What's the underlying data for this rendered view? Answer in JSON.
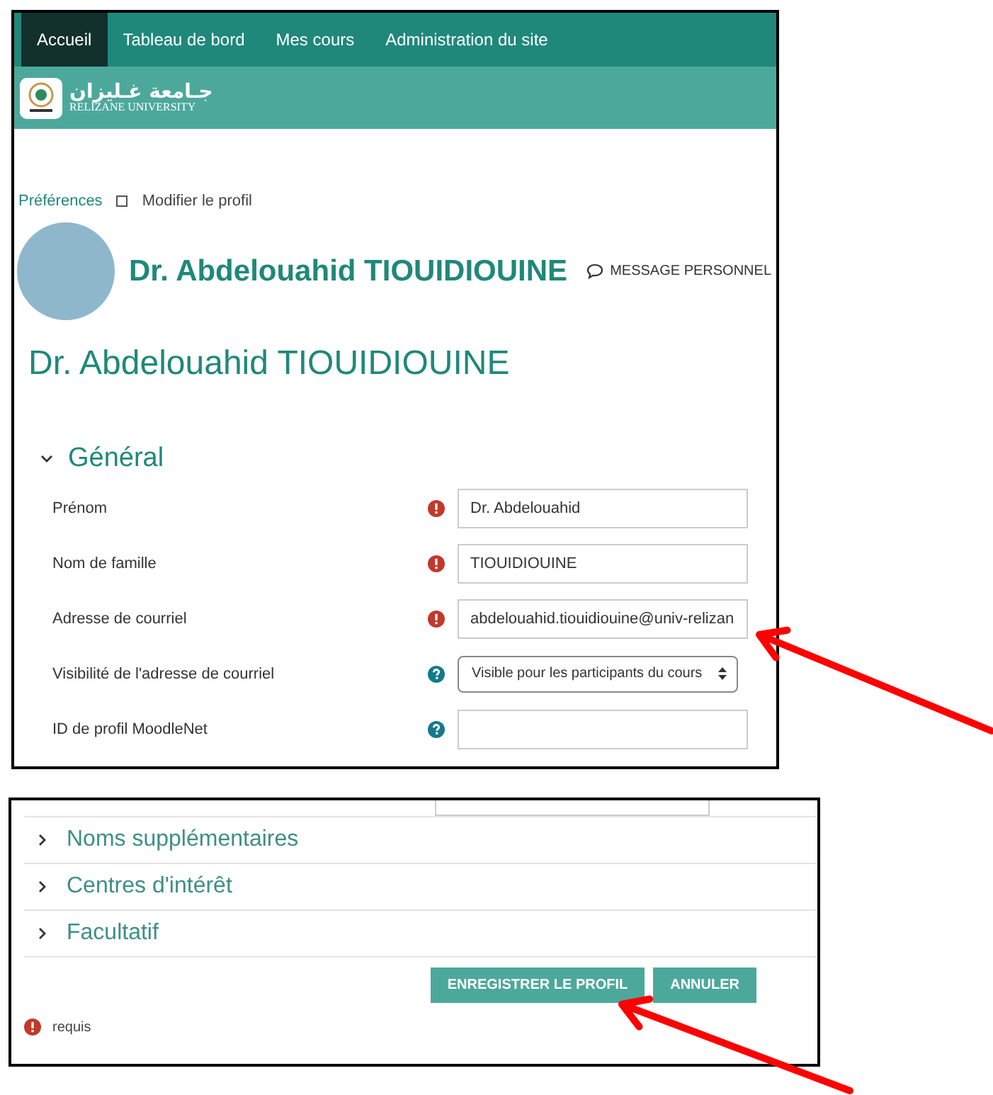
{
  "top_screenshot": {
    "nav": {
      "tabs": [
        {
          "label": "Accueil",
          "selected": true
        },
        {
          "label": "Tableau de bord",
          "selected": false
        },
        {
          "label": "Mes cours",
          "selected": false
        },
        {
          "label": "Administration du site",
          "selected": false
        }
      ]
    },
    "logo": {
      "arabic": "جـامعة غـليزان",
      "latin": "RELIZANE UNIVERSITY"
    },
    "breadcrumb": [
      "Préférences",
      "Modifier le profil"
    ],
    "profile": {
      "name": "Dr. Abdelouahid TIOUIDIOUINE",
      "message_button": "MESSAGE PERSONNEL"
    },
    "page_title": "Dr. Abdelouahid TIOUIDIOUINE",
    "general": {
      "title": "Général",
      "expanded": true,
      "fields": [
        {
          "label": "Prénom",
          "required": true,
          "kind": "text",
          "value": "Dr. Abdelouahid"
        },
        {
          "label": "Nom de famille",
          "required": true,
          "kind": "text",
          "value": "TIOUIDIOUINE"
        },
        {
          "label": "Adresse de courriel",
          "required": true,
          "kind": "text",
          "value": "abdelouahid.tiouidiouine@univ-relizan"
        },
        {
          "label": "Visibilité de l'adresse de courriel",
          "required": false,
          "kind": "select",
          "value": "Visible pour les participants du cours"
        },
        {
          "label": "ID de profil MoodleNet",
          "required": false,
          "kind": "text"
        }
      ]
    }
  },
  "bottom_screenshot": {
    "sections": [
      {
        "title": "Noms supplémentaires",
        "expanded": false
      },
      {
        "title": "Centres d'intérêt",
        "expanded": false
      },
      {
        "title": "Facultatif",
        "expanded": false
      }
    ],
    "buttons": [
      {
        "label": "ENREGISTRER LE PROFIL"
      },
      {
        "label": "ANNULER"
      }
    ],
    "legend": "requis"
  }
}
